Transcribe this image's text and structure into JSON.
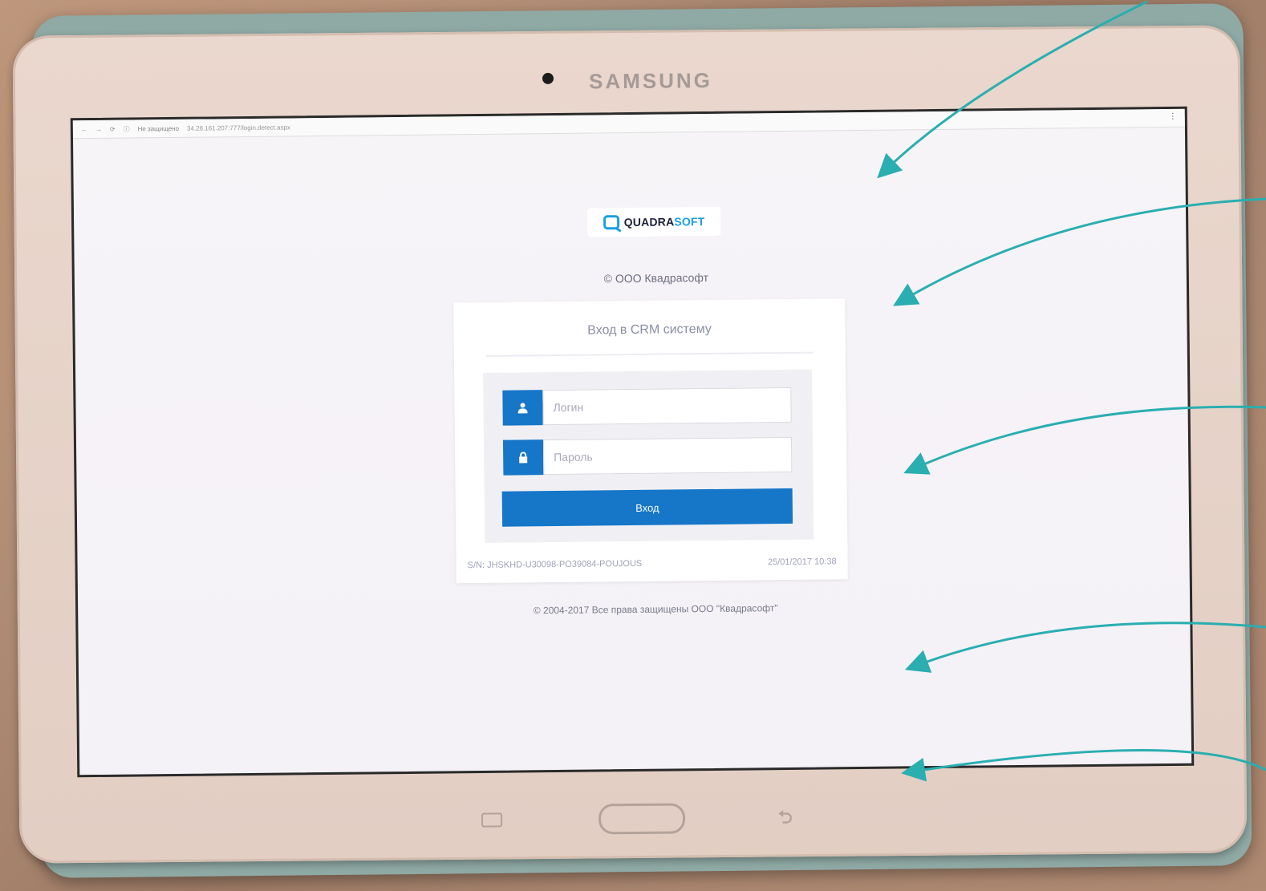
{
  "device": {
    "brand": "SAMSUNG"
  },
  "browser": {
    "security_label": "Не защищено",
    "url": "34.28.161.207:777/login.detect.aspx"
  },
  "logo": {
    "part1": "QUADRA",
    "part2": "SOFT"
  },
  "company": "© ООО Квадрасофт",
  "login_card": {
    "title": "Вход в CRM систему",
    "login_placeholder": "Логин",
    "password_placeholder": "Пароль",
    "submit_label": "Вход",
    "serial": "S/N: JHSKHD-U30098-PO39084-POUJOUS",
    "timestamp": "25/01/2017 10:38"
  },
  "footer": {
    "copyright": "© 2004-2017 Все права защищены ООО \"Квадрасофт\""
  },
  "colors": {
    "accent": "#1676c8",
    "logo_blue": "#1a9fe0",
    "annotation_arrow": "#2aaeb0"
  },
  "icons": {
    "login_field": "user-icon",
    "password_field": "lock-icon"
  }
}
